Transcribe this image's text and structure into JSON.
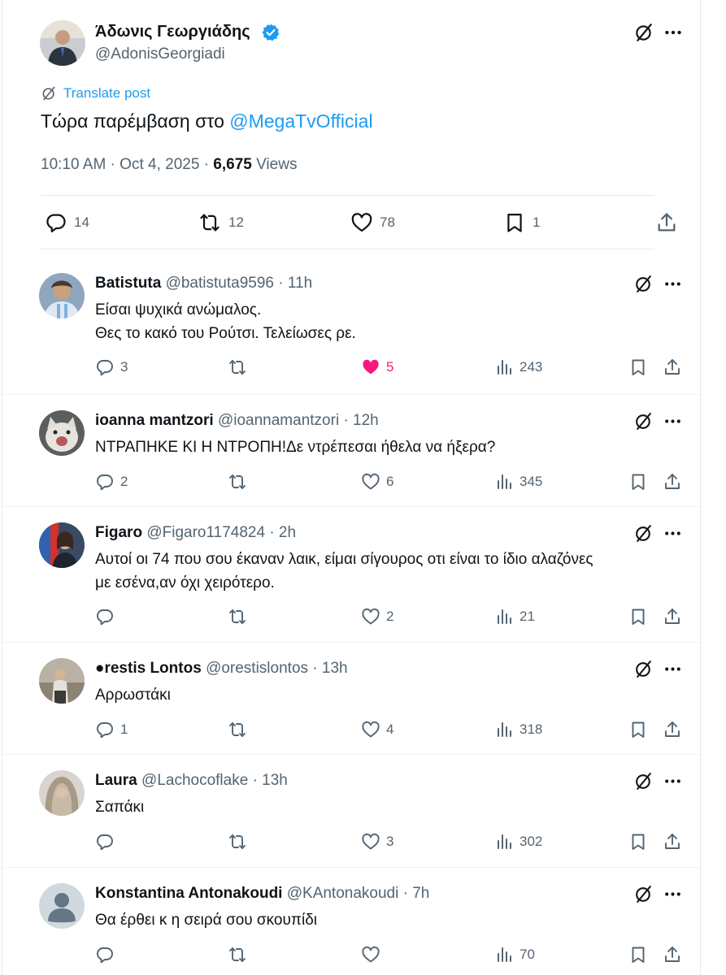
{
  "colors": {
    "accent": "#1d9bf0",
    "like_active": "#f91880",
    "muted": "#536471",
    "text": "#0f1419"
  },
  "main_post": {
    "author_name": "Άδωνις Γεωργιάδης",
    "handle": "@AdonisGeorgiadi",
    "translate_label": "Translate post",
    "text": "Τώρα παρέμβαση στο ",
    "mention": "@MegaTvOfficial",
    "time": "10:10 AM · Oct 4, 2025 · ",
    "views_count": "6,675",
    "views_label": " Views",
    "stats": {
      "replies": "14",
      "reposts": "12",
      "likes": "78",
      "bookmarks": "1"
    },
    "icons": [
      "grok-icon",
      "more-icon",
      "reply-icon",
      "repost-icon",
      "like-icon",
      "bookmark-icon",
      "share-icon"
    ]
  },
  "replies": [
    {
      "name": "Batistuta",
      "handle": "@batistuta9596 · 11h",
      "lines": [
        "Είσαι ψυχικά ανώμαλος.",
        "Θες το κακό του Ρούτσι. Τελείωσες ρε."
      ],
      "replies": "3",
      "reposts": "",
      "likes": "5",
      "views": "243",
      "liked": true
    },
    {
      "name": "ioanna mantzori",
      "handle": "@ioannamantzori · 12h",
      "lines": [
        "ΝΤΡΑΠΗΚΕ ΚΙ Η ΝΤΡΟΠΗ!Δε ντρέπεσαι ήθελα να ήξερα?"
      ],
      "replies": "2",
      "reposts": "",
      "likes": "6",
      "views": "345",
      "liked": false
    },
    {
      "name": "Figaro",
      "handle": "@Figaro1174824 · 2h",
      "lines": [
        "Αυτοί οι 74 που σου έκαναν λαικ, είμαι σίγουρος οτι είναι το ίδιο  αλαζόνες",
        "με εσένα,αν όχι χειρότερο."
      ],
      "replies": "",
      "reposts": "",
      "likes": "2",
      "views": "21",
      "liked": false
    },
    {
      "name": "●restis Lontos",
      "handle": "@orestislontos · 13h",
      "lines": [
        "Αρρωστάκι"
      ],
      "replies": "1",
      "reposts": "",
      "likes": "4",
      "views": "318",
      "liked": false
    },
    {
      "name": "Laura",
      "handle": "@Lachocoflake · 13h",
      "lines": [
        "Σαπάκι"
      ],
      "replies": "",
      "reposts": "",
      "likes": "3",
      "views": "302",
      "liked": false
    },
    {
      "name": "Konstantina Antonakoudi",
      "handle": "@KAntonakoudi · 7h",
      "lines": [
        "Θα έρθει κ η σειρά σου σκουπίδι"
      ],
      "replies": "",
      "reposts": "",
      "likes": "",
      "views": "70",
      "liked": false
    }
  ]
}
